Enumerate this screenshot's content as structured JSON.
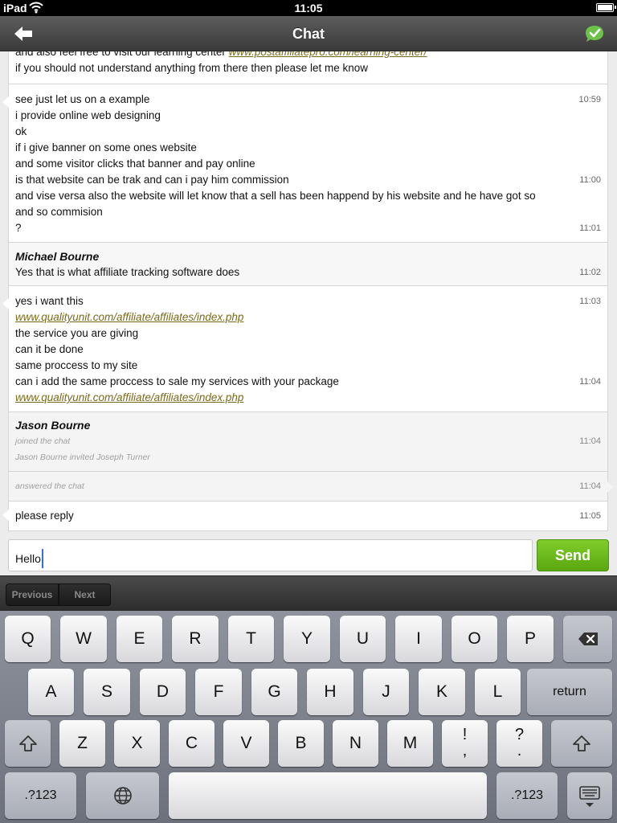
{
  "status_bar": {
    "carrier": "iPad",
    "time": "11:05"
  },
  "nav": {
    "title": "Chat"
  },
  "messages": [
    {
      "type": "visitor",
      "lines": [
        {
          "text": "and also feel free to visit our learning center ",
          "link": "www.postaffiliatepro.com/learning-center/",
          "time": ""
        },
        {
          "text": "if you should not understand anything from there then please let me know",
          "link": "",
          "time": ""
        }
      ]
    },
    {
      "type": "visitor",
      "lines": [
        {
          "text": "see just let us on a example",
          "link": "",
          "time": "10:59"
        },
        {
          "text": "i provide online web designing",
          "link": "",
          "time": ""
        },
        {
          "text": "ok",
          "link": "",
          "time": ""
        },
        {
          "text": "if i give banner on some ones website",
          "link": "",
          "time": ""
        },
        {
          "text": "and some visitor clicks that banner and pay online",
          "link": "",
          "time": ""
        },
        {
          "text": "is that website can be trak and can i pay him commission",
          "link": "",
          "time": "11:00"
        },
        {
          "text": "and vise versa also the website will let know that a sell has been happend by his website and he have got so",
          "link": "",
          "time": ""
        },
        {
          "text": "and so commision",
          "link": "",
          "time": ""
        },
        {
          "text": "?",
          "link": "",
          "time": "11:01"
        }
      ]
    },
    {
      "type": "agent",
      "author": "Michael Bourne",
      "lines": [
        {
          "text": "Yes that is what affiliate tracking software does",
          "link": "",
          "time": "11:02"
        }
      ]
    },
    {
      "type": "visitor",
      "lines": [
        {
          "text": "yes i want this",
          "link": "",
          "time": "11:03"
        },
        {
          "text": "",
          "link": "www.qualityunit.com/affiliate/affiliates/index.php",
          "time": ""
        },
        {
          "text": "the service you are giving",
          "link": "",
          "time": ""
        },
        {
          "text": "can it be done",
          "link": "",
          "time": ""
        },
        {
          "text": "same proccess to my site",
          "link": "",
          "time": ""
        },
        {
          "text": "can i add the same proccess to sale my services with your package",
          "link": "",
          "time": "11:04"
        },
        {
          "text": "",
          "link": "www.qualityunit.com/affiliate/affiliates/index.php",
          "time": ""
        }
      ]
    },
    {
      "type": "agent",
      "author": "Jason Bourne",
      "system_lines": [
        {
          "text": "joined the chat",
          "time": "11:04"
        },
        {
          "text": "Jason Bourne invited Joseph Turner",
          "time": ""
        }
      ]
    },
    {
      "type": "system",
      "system_lines": [
        {
          "text": "answered the chat",
          "time": "11:04"
        }
      ]
    },
    {
      "type": "visitor",
      "lines": [
        {
          "text": "please reply",
          "link": "",
          "time": "11:05"
        }
      ]
    }
  ],
  "composer": {
    "value": "Hello",
    "send_label": "Send"
  },
  "form_assistant": {
    "previous_label": "Previous",
    "next_label": "Next"
  },
  "keyboard": {
    "row1": [
      "Q",
      "W",
      "E",
      "R",
      "T",
      "Y",
      "U",
      "I",
      "O",
      "P"
    ],
    "row2": [
      "A",
      "S",
      "D",
      "F",
      "G",
      "H",
      "J",
      "K",
      "L"
    ],
    "row3": [
      "Z",
      "X",
      "C",
      "V",
      "B",
      "N",
      "M"
    ],
    "punct1": [
      "!",
      ","
    ],
    "punct2": [
      "?",
      "."
    ],
    "return_label": "return",
    "numbers_label": ".?123",
    "icons": [
      "backspace-icon",
      "shift-icon",
      "globe-icon",
      "hide-keyboard-icon"
    ]
  },
  "colors": {
    "send_green": "#5aa710",
    "link": "#7a6a1a",
    "caret": "#3a6fd8",
    "online_check": "#6cc24a"
  }
}
